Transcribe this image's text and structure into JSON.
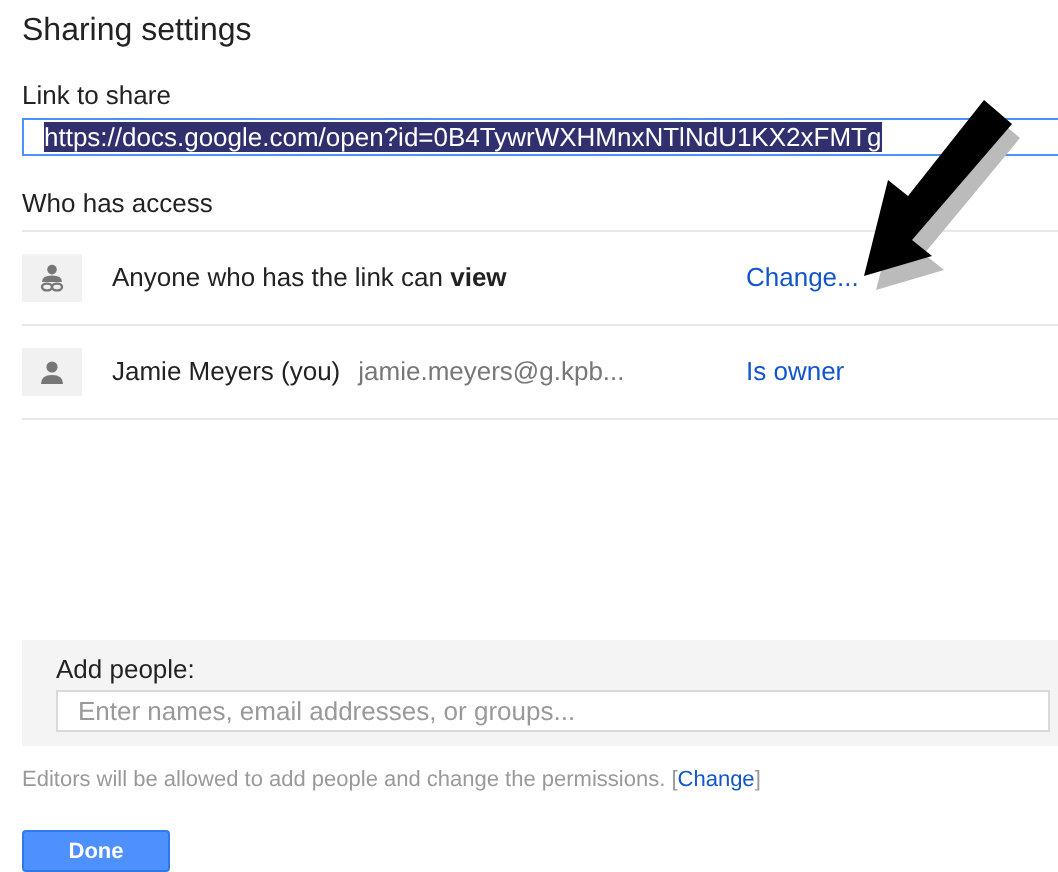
{
  "title": "Sharing settings",
  "link_section": {
    "label": "Link to share",
    "value": "https://docs.google.com/open?id=0B4TywrWXHMnxNTlNdU1KX2xFMTg",
    "selected": true
  },
  "access": {
    "heading": "Who has access",
    "rows": [
      {
        "kind": "link",
        "text": "Anyone who has the link can **view**",
        "action": "Change..."
      },
      {
        "kind": "person",
        "text": "Jamie Meyers (you)",
        "email": "jamie.meyers@g.kpb...",
        "action": "Is owner"
      }
    ]
  },
  "add_people": {
    "label": "Add people:",
    "placeholder": "Enter names, email addresses, or groups..."
  },
  "note": {
    "before": "Editors will be allowed to add people and change the permissions. [",
    "link": "Change",
    "after": "]"
  },
  "done_button": "Done"
}
